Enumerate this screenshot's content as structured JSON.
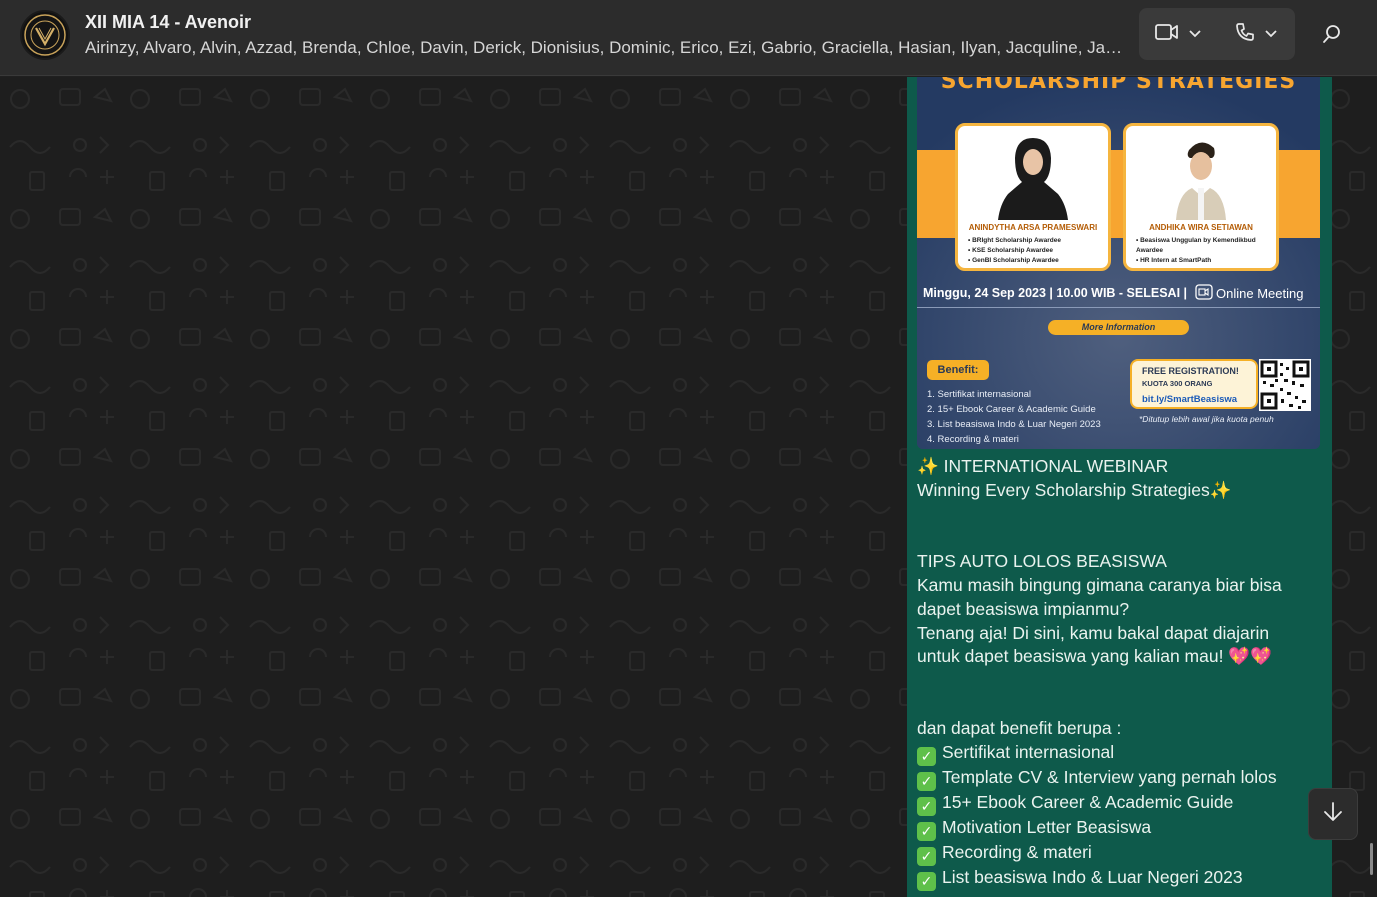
{
  "header": {
    "title": "XII MIA 14 - Avenoir",
    "members": "Airinzy, Alvaro, Alvin, Azzad, Brenda, Chloe, Davin, Derick, Dionisius, Dominic, Erico, Ezi, Gabrio, Graciella, Hasian, Ilyan, Jacquline, Jame...",
    "icons": {
      "avatar": "group-avatar",
      "video": "video-camera-icon",
      "voice": "phone-icon",
      "search": "search-icon",
      "dropdown": "chevron-down-icon"
    }
  },
  "poster": {
    "title": "SCHOLARSHIP STRATEGIES",
    "speaker1": {
      "name": "ANINDYTHA ARSA PRAMESWARI",
      "items": [
        "BRIght Scholarship Awardee",
        "KSE Scholarship Awardee",
        "GenBI Scholarship Awardee"
      ]
    },
    "speaker2": {
      "name": "ANDHIKA WIRA SETIAWAN",
      "items": [
        "Beasiswa Unggulan by Kemendikbud Awardee",
        "HR Intern at SmartPath"
      ]
    },
    "date": "Minggu, 24 Sep 2023 | 10.00 WIB - SELESAI |",
    "online": "Online Meeting",
    "more_info": "More Information",
    "benefit_label": "Benefit:",
    "benefits": [
      "1. Sertifikat internasional",
      "2. 15+ Ebook Career & Academic Guide",
      "3. List beasiswa Indo & Luar Negeri 2023",
      "4. Recording & materi"
    ],
    "reg_title": "FREE REGISTRATION!",
    "reg_quota": "KUOTA 300 ORANG",
    "reg_link": "bit.ly/SmartBeasiswa",
    "reg_note": "*Ditutup lebih awal jika kuota penuh"
  },
  "message": {
    "lines": [
      "✨ INTERNATIONAL WEBINAR",
      "Winning Every Scholarship Strategies✨",
      "",
      "",
      "TIPS AUTO LOLOS BEASISWA",
      "Kamu masih bingung gimana caranya biar bisa",
      "dapet beasiswa impianmu?",
      "Tenang aja! Di sini, kamu bakal dapat diajarin",
      "untuk dapet beasiswa yang kalian mau! 💖💖",
      "",
      "",
      "dan dapat benefit berupa :"
    ],
    "checklist": [
      "Sertifikat internasional",
      "Template CV & Interview yang pernah lolos",
      "15+ Ebook Career & Academic Guide",
      "Motivation Letter Beasiswa",
      "Recording & materi",
      "List beasiswa Indo & Luar Negeri 2023"
    ]
  },
  "scroll_down_icon": "arrow-down-icon",
  "colors": {
    "bubble": "#0e5a4b",
    "header": "#2c2c2c",
    "chat_bg": "#1e1e1e",
    "check": "#5fc04a",
    "poster_accent": "#f7a530"
  }
}
